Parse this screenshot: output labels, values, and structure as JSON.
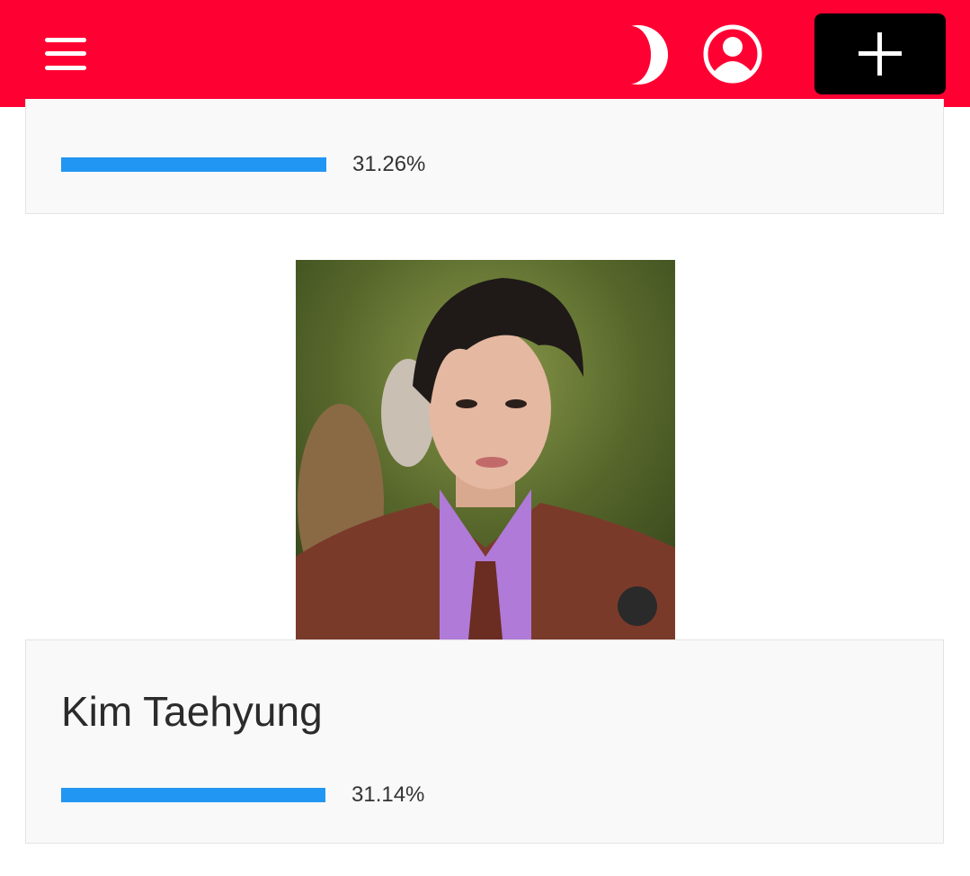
{
  "header": {
    "background": "#ff0033",
    "menu_icon": "hamburger-menu-icon",
    "theme_icon": "moon-icon",
    "account_icon": "user-circle-icon",
    "add_icon": "plus-icon"
  },
  "entries": [
    {
      "percentage_label": "31.26%",
      "percentage": 31.26
    },
    {
      "name": "Kim Taehyung",
      "percentage_label": "31.14%",
      "percentage": 31.14
    }
  ],
  "colors": {
    "bar": "#2196f3",
    "card_bg": "#f9f9f9"
  }
}
